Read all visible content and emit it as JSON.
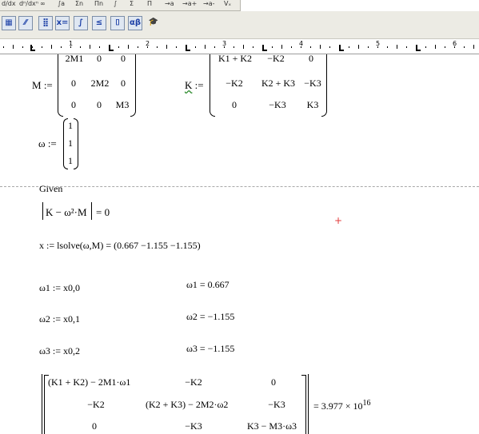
{
  "calc_toolbar": {
    "buttons": [
      "d/dx",
      "dⁿ/dxⁿ",
      "∞",
      "∫a",
      "Σn",
      "Πn",
      "∫",
      "Σ",
      "Π",
      "→a",
      "→a+",
      "→a-",
      "Vₓ"
    ]
  },
  "palette_toolbar": {
    "buttons": [
      {
        "name": "calculator-palette-button",
        "glyph": "▦"
      },
      {
        "name": "graph-palette-button",
        "glyph": "⁄⁄"
      },
      {
        "name": "matrix-palette-button",
        "glyph": "⣿"
      },
      {
        "name": "evaluation-palette-button",
        "glyph": "x="
      },
      {
        "name": "calculus-palette-button",
        "glyph": "∫"
      },
      {
        "name": "boolean-palette-button",
        "glyph": "≤"
      },
      {
        "name": "programming-palette-button",
        "glyph": "⌷"
      },
      {
        "name": "greek-palette-button",
        "glyph": "αβ"
      },
      {
        "name": "symbolic-palette-button",
        "glyph": "🎓"
      }
    ]
  },
  "ruler": {
    "numbers": [
      "1",
      "2",
      "3",
      "4",
      "5",
      "6"
    ]
  },
  "worksheet": {
    "M_def": {
      "name": "M",
      "assign": ":=",
      "matrix": [
        [
          "2M1",
          "0",
          "0"
        ],
        [
          "0",
          "2M2",
          "0"
        ],
        [
          "0",
          "0",
          "M3"
        ]
      ]
    },
    "K_def": {
      "name": "K",
      "assign": ":=",
      "matrix": [
        [
          "K1 + K2",
          "−K2",
          "0"
        ],
        [
          "−K2",
          "K2 + K3",
          "−K3"
        ],
        [
          "0",
          "−K3",
          "K3"
        ]
      ]
    },
    "omega_def": {
      "name": "ω",
      "assign": ":=",
      "vector": [
        "1",
        "1",
        "1"
      ]
    },
    "given": "Given",
    "det_eq": {
      "lhs": "K − ω²·M",
      "rhs": "= 0"
    },
    "lsolve": {
      "text": "x := lsolve(ω,M) = ",
      "result": "(0.667  −1.155  −1.155)"
    },
    "assignments": [
      {
        "lhs": "ω1 := x0,0",
        "eval": "ω1 = 0.667"
      },
      {
        "lhs": "ω2 := x0,1",
        "eval": "ω2 = −1.155"
      },
      {
        "lhs": "ω3 := x0,2",
        "eval": "ω3 = −1.155"
      }
    ],
    "det_matrix": {
      "cells": [
        [
          "(K1 + K2) − 2M1·ω1",
          "−K2",
          "0"
        ],
        [
          "−K2",
          "(K2 + K3) − 2M2·ω2",
          "−K3"
        ],
        [
          "0",
          "−K3",
          "K3 − M3·ω3"
        ]
      ],
      "result": "= 3.977 × 10",
      "exponent": "16"
    }
  }
}
